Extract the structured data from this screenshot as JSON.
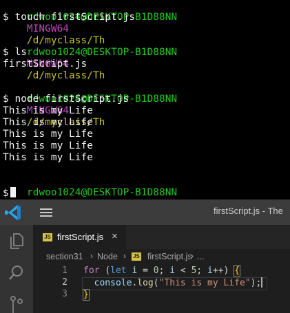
{
  "terminal": {
    "prompt_user": "rdwoo1024@DESKTOP-B1D88NN",
    "prompt_env": "MINGW64",
    "prompt_path": "/d/myclass/Th",
    "commands": [
      "$ touch firstScript.js",
      "$ ls",
      "$ node firstScript.js",
      "$"
    ],
    "ls_output": "firstScript.js",
    "node_output": [
      "This is my Life",
      "This is my Life",
      "This is my Life",
      "This is my Life",
      "This is my Life"
    ]
  },
  "titlebar": {
    "title": "firstScript.js - The"
  },
  "tab": {
    "badge": "JS",
    "label": "firstScript.js",
    "close": "×"
  },
  "breadcrumb": {
    "items": [
      "section31",
      "Node",
      "firstScript.js",
      "..."
    ],
    "separator": "›"
  },
  "editor": {
    "line_numbers": [
      "1",
      "2",
      "3"
    ],
    "lines": {
      "l1": {
        "kw": "for",
        "p1": " (",
        "let": "let",
        "v1": " i",
        "p2": " = ",
        "n1": "0",
        "p3": "; ",
        "v2": "i",
        "p4": " < ",
        "n2": "5",
        "p5": "; ",
        "v3": "i",
        "p6": "++) ",
        "brace": "{"
      },
      "l2": {
        "obj": "console",
        "dot": ".",
        "fn": "log",
        "p1": "(",
        "str": "\"This is my Life\"",
        "p2": ");"
      },
      "l3": {
        "brace": "}"
      }
    }
  },
  "colors": {
    "terminal_user": "#1ec71e",
    "terminal_env": "#c248c2",
    "terminal_path": "#c7c31a",
    "vscode_accent": "#007acc",
    "js_badge": "#d6c343"
  }
}
